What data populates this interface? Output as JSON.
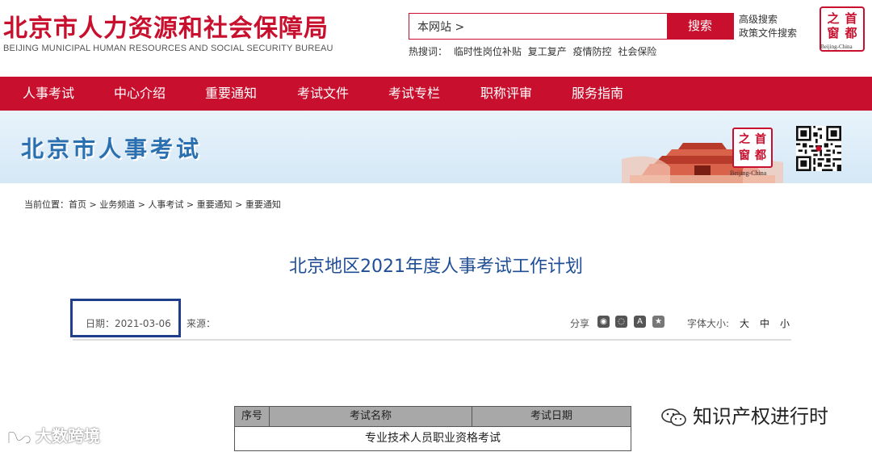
{
  "header": {
    "title": "北京市人力资源和社会保障局",
    "subtitle": "BEIJING MUNICIPAL HUMAN RESOURCES AND SOCIAL SECURITY BUREAU",
    "search": {
      "value": "本网站 >",
      "button_label": "搜索"
    },
    "advanced_search": "高级搜索",
    "policy_search": "政策文件搜索",
    "hot_words": {
      "label": "热搜词：",
      "items": [
        "临时性岗位补贴",
        "复工复产",
        "疫情防控",
        "社会保险"
      ]
    },
    "seal": {
      "chars": [
        "之",
        "首",
        "窗",
        "都"
      ],
      "caption": "Beijing-China"
    }
  },
  "nav": {
    "items": [
      {
        "label": "人事考试"
      },
      {
        "label": "中心介绍"
      },
      {
        "label": "重要通知"
      },
      {
        "label": "考试文件"
      },
      {
        "label": "考试专栏"
      },
      {
        "label": "职称评审"
      },
      {
        "label": "服务指南"
      }
    ]
  },
  "banner": {
    "title": "北京市人事考试",
    "seal": {
      "chars": [
        "之",
        "首",
        "窗",
        "都"
      ],
      "caption": "Beijing-China"
    }
  },
  "breadcrumb": "当前位置：首页 > 业务频道 > 人事考试 > 重要通知 > 重要通知",
  "article": {
    "title": "北京地区2021年度人事考试工作计划",
    "date": "日期：2021-03-06",
    "source": "来源：",
    "share_label": "分享",
    "font_size_label": "字体大小:",
    "font_sizes": [
      "大",
      "中",
      "小"
    ]
  },
  "table": {
    "headers": [
      "序号",
      "考试名称",
      "考试日期"
    ],
    "section_row": "专业技术人员职业资格考试"
  },
  "watermarks": {
    "left": "大数跨境",
    "right": "知识产权进行时"
  },
  "colors": {
    "brand_red": "#c8102e",
    "title_blue": "#1f4e96",
    "banner_blue": "#2a6fb0",
    "highlight_box": "#1f3f8a"
  }
}
